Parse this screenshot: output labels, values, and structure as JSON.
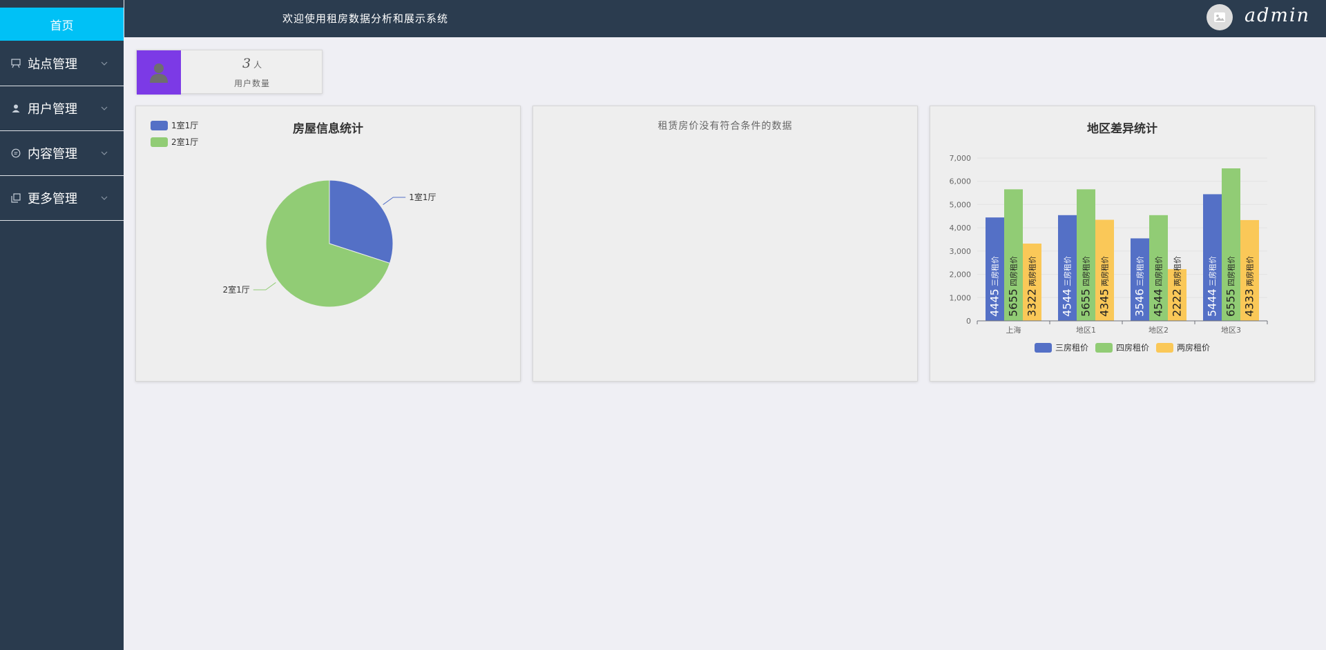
{
  "sidebar": {
    "home_label": "首页",
    "items": [
      {
        "label": "站点管理",
        "icon": "monitor-icon"
      },
      {
        "label": "用户管理",
        "icon": "user-icon"
      },
      {
        "label": "内容管理",
        "icon": "chat-icon"
      },
      {
        "label": "更多管理",
        "icon": "copy-icon"
      }
    ]
  },
  "header": {
    "welcome": "欢迎使用租房数据分析和展示系统",
    "username": "admin"
  },
  "stat": {
    "value": "3",
    "unit": "人",
    "label": "用户数量"
  },
  "colors": {
    "sidebar_bg": "#2a3b4e",
    "header_bg": "#2b3c4f",
    "accent": "#00c1f6",
    "stat_icon_bg": "#7c3ae6",
    "blue": "#5470c6",
    "green": "#91cc75",
    "yellow": "#fac858"
  },
  "panels": {
    "rent_price_empty": "租赁房价没有符合条件的数据"
  },
  "chart_data": [
    {
      "type": "pie",
      "title": "房屋信息统计",
      "labels": [
        "1室1厅",
        "2室1厅"
      ],
      "values": [
        30,
        70
      ],
      "colors": [
        "#5470c6",
        "#91cc75"
      ],
      "legend": "top-left"
    },
    {
      "type": "bar",
      "title": "地区差异统计",
      "categories": [
        "上海",
        "地区1",
        "地区2",
        "地区3"
      ],
      "series": [
        {
          "name": "三房租价",
          "values": [
            4445,
            4544,
            3546,
            5444
          ],
          "color": "#5470c6"
        },
        {
          "name": "四房租价",
          "values": [
            5655,
            5655,
            4544,
            6555
          ],
          "color": "#91cc75"
        },
        {
          "name": "两房租价",
          "values": [
            3322,
            4345,
            2222,
            4333
          ],
          "color": "#fac858"
        }
      ],
      "yticks": [
        "0",
        "1,000",
        "2,000",
        "3,000",
        "4,000",
        "5,000",
        "6,000",
        "7,000"
      ],
      "ylim": [
        0,
        7000
      ],
      "legend": "bottom",
      "grid": true
    }
  ]
}
